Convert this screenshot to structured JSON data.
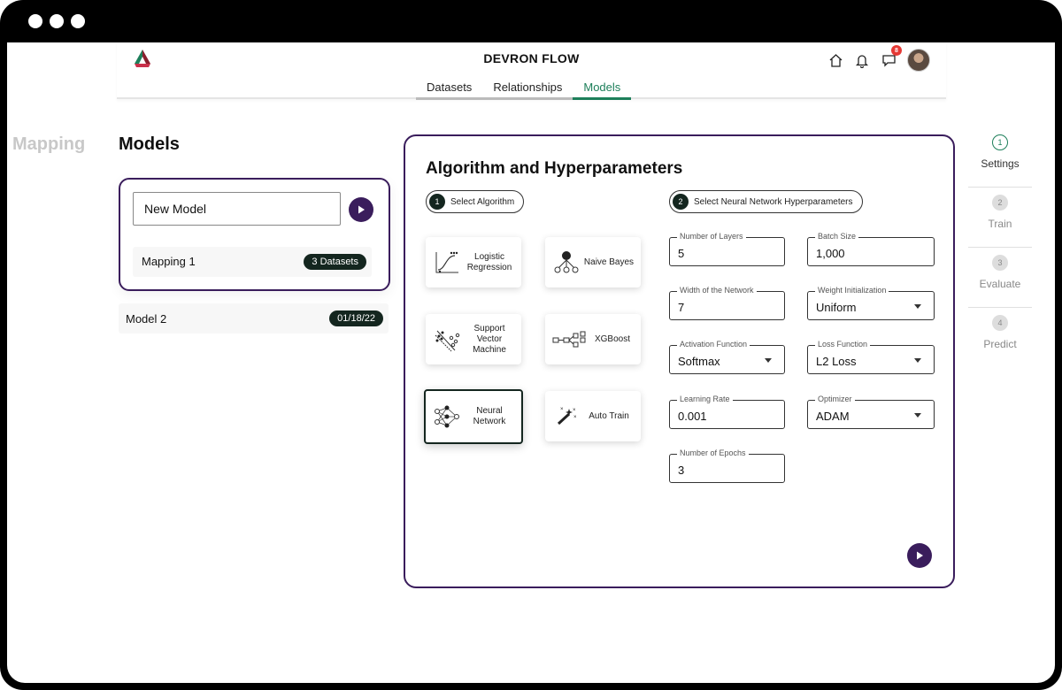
{
  "app": {
    "title": "DEVRON FLOW",
    "notification_count": "8"
  },
  "tabs": [
    {
      "label": "Datasets"
    },
    {
      "label": "Relationships"
    },
    {
      "label": "Models"
    }
  ],
  "sidebar_label": "Mapping",
  "models": {
    "title": "Models",
    "new_model_value": "New Model",
    "mapping": {
      "name": "Mapping 1",
      "badge": "3 Datasets"
    },
    "model2": {
      "name": "Model 2",
      "date": "01/18/22"
    }
  },
  "panel": {
    "title": "Algorithm and Hyperparameters",
    "step1": {
      "num": "1",
      "label": "Select Algorithm"
    },
    "step2": {
      "num": "2",
      "label": "Select Neural Network Hyperparameters"
    }
  },
  "algorithms": [
    {
      "label": "Logistic Regression",
      "icon": "logistic-regression-icon"
    },
    {
      "label": "Naive Bayes",
      "icon": "naive-bayes-icon"
    },
    {
      "label": "Support Vector Machine",
      "icon": "svm-icon"
    },
    {
      "label": "XGBoost",
      "icon": "xgboost-icon"
    },
    {
      "label": "Neural Network",
      "icon": "neural-network-icon",
      "selected": true
    },
    {
      "label": "Auto Train",
      "icon": "auto-train-icon"
    }
  ],
  "hyperparameters": {
    "num_layers": {
      "label": "Number of Layers",
      "value": "5"
    },
    "batch_size": {
      "label": "Batch Size",
      "value": "1,000"
    },
    "width": {
      "label": "Width of the Network",
      "value": "7"
    },
    "weight_init": {
      "label": "Weight Initialization",
      "value": "Uniform"
    },
    "activation": {
      "label": "Activation Function",
      "value": "Softmax"
    },
    "loss": {
      "label": "Loss Function",
      "value": "L2 Loss"
    },
    "learning_rate": {
      "label": "Learning Rate",
      "value": "0.001"
    },
    "optimizer": {
      "label": "Optimizer",
      "value": "ADAM"
    },
    "epochs": {
      "label": "Number of Epochs",
      "value": "3"
    }
  },
  "stepper": [
    {
      "num": "1",
      "label": "Settings",
      "active": true
    },
    {
      "num": "2",
      "label": "Train"
    },
    {
      "num": "3",
      "label": "Evaluate"
    },
    {
      "num": "4",
      "label": "Predict"
    }
  ],
  "colors": {
    "accent_purple": "#3a1d5c",
    "accent_green": "#1d7f5a",
    "dark": "#14261f"
  }
}
